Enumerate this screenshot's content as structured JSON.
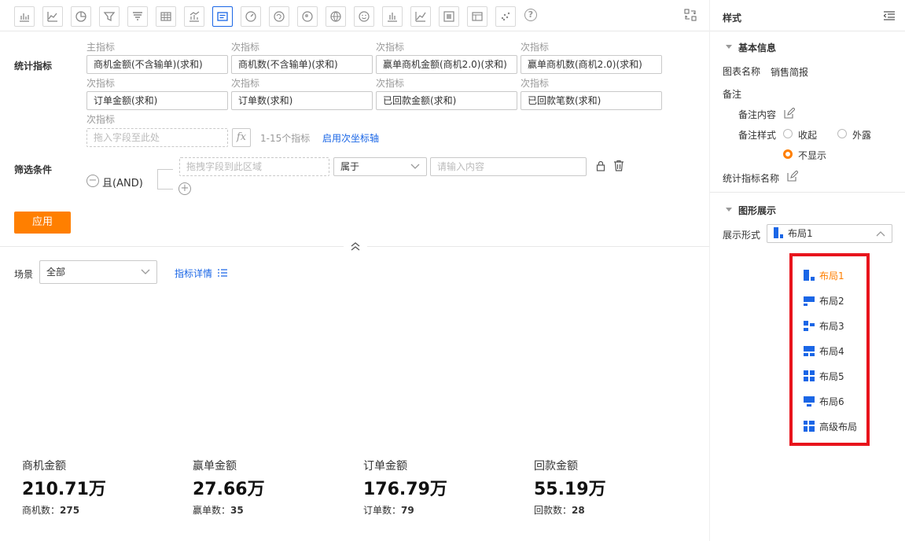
{
  "toolbar": {
    "icons": [
      "bar-chart-icon",
      "line-chart-icon",
      "pie-chart-icon",
      "funnel-icon",
      "funnel-compare-icon",
      "table-icon",
      "combo-chart-icon",
      "kpi-card-icon",
      "gauge-icon",
      "china-map-icon",
      "heat-map-icon",
      "world-map-icon",
      "smile-icon",
      "bar-chart-2-icon",
      "line-chart-2-icon",
      "pivot-table-icon",
      "detail-table-icon",
      "scatter-icon"
    ],
    "active": "kpi-card-icon",
    "help_glyph": "?",
    "swap_icon": "swap-icon"
  },
  "metrics": {
    "label": "统计指标",
    "items": [
      {
        "tag": "主指标",
        "value": "商机金额(不含输单)(求和)"
      },
      {
        "tag": "次指标",
        "value": "商机数(不含输单)(求和)"
      },
      {
        "tag": "次指标",
        "value": "赢单商机金额(商机2.0)(求和)"
      },
      {
        "tag": "次指标",
        "value": "赢单商机数(商机2.0)(求和)"
      },
      {
        "tag": "次指标",
        "value": "订单金额(求和)"
      },
      {
        "tag": "次指标",
        "value": "订单数(求和)"
      },
      {
        "tag": "次指标",
        "value": "已回款金额(求和)"
      },
      {
        "tag": "次指标",
        "value": "已回款笔数(求和)"
      }
    ],
    "drop": {
      "tag": "次指标",
      "placeholder": "拖入字段至此处"
    },
    "fx": "fx",
    "range_hint": "1-15个指标",
    "secondary_axis_link": "启用次坐标轴"
  },
  "filter": {
    "label": "筛选条件",
    "logic": "且(AND)",
    "minus": "−",
    "plus": "+",
    "drop_placeholder": "拖拽字段到此区域",
    "operator": "属于",
    "value_placeholder": "请输入内容",
    "lock_icon": "lock-icon",
    "delete_icon": "trash-icon"
  },
  "apply_button": "应用",
  "collapse_icon": "double-chevron-up-icon",
  "scene": {
    "label": "场景",
    "value": "全部",
    "detail_link": "指标详情"
  },
  "kpis": [
    {
      "title": "商机金额",
      "value": "210.71万",
      "sub_label": "商机数：",
      "sub_value": "275"
    },
    {
      "title": "赢单金额",
      "value": "27.66万",
      "sub_label": "赢单数：",
      "sub_value": "35"
    },
    {
      "title": "订单金额",
      "value": "176.79万",
      "sub_label": "订单数：",
      "sub_value": "79"
    },
    {
      "title": "回款金额",
      "value": "55.19万",
      "sub_label": "回款数：",
      "sub_value": "28"
    }
  ],
  "panel": {
    "title": "样式",
    "basic_section": "基本信息",
    "chart_name_label": "图表名称",
    "chart_name_value": "销售简报",
    "remark_label": "备注",
    "remark_content_label": "备注内容",
    "remark_style_label": "备注样式",
    "remark_options": [
      "收起",
      "外露",
      "不显示"
    ],
    "remark_selected": "不显示",
    "metric_name_label": "统计指标名称",
    "display_section": "图形展示",
    "display_mode_label": "展示形式",
    "display_mode_value": "布局1",
    "layout_options": [
      "布局1",
      "布局2",
      "布局3",
      "布局4",
      "布局5",
      "布局6",
      "高级布局"
    ],
    "layout_selected": "布局1"
  },
  "colors": {
    "accent": "#ff7f00",
    "link": "#1a66e6",
    "highlight_border": "#e8141c"
  }
}
